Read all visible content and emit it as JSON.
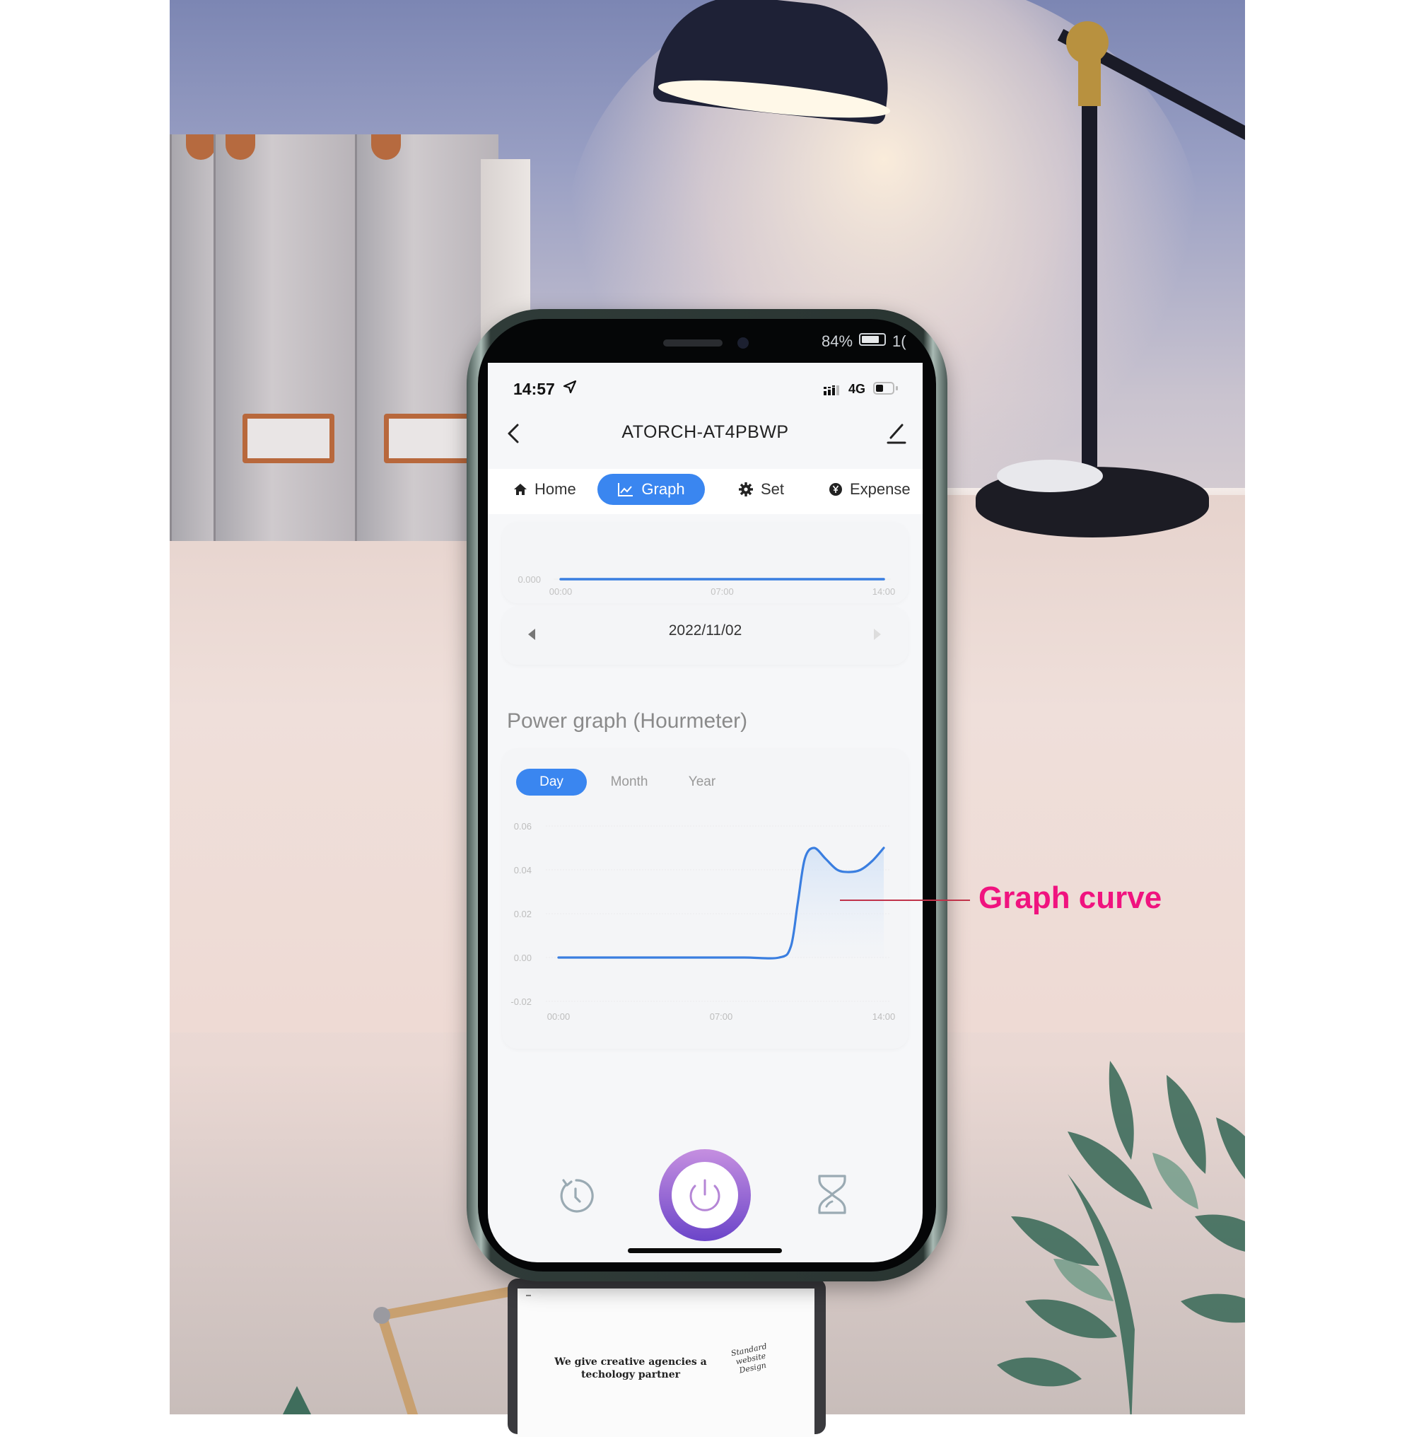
{
  "background_photo": {
    "tablet_headline": "We give creative agencies a techology partner",
    "tablet_script": "Standard website Design"
  },
  "phone_bezel": {
    "battery_percent": "84%",
    "battery_tail": "1("
  },
  "status_bar": {
    "time": "14:57",
    "location_icon": "location-arrow-icon",
    "network": "4G",
    "battery_level": 0.45
  },
  "header": {
    "title": "ATORCH-AT4PBWP",
    "back_icon": "chevron-left-icon",
    "edit_icon": "pencil-icon"
  },
  "tabs": [
    {
      "label": "Home",
      "icon": "home-icon",
      "active": false
    },
    {
      "label": "Graph",
      "icon": "line-chart-icon",
      "active": true
    },
    {
      "label": "Set",
      "icon": "gear-icon",
      "active": false
    },
    {
      "label": "Expense",
      "icon": "yen-coin-icon",
      "active": false
    }
  ],
  "date_nav": {
    "date": "2022/11/02",
    "prev_icon": "caret-left-icon",
    "next_icon": "caret-right-icon"
  },
  "power_graph": {
    "title": "Power graph (Hourmeter)",
    "periods": [
      {
        "label": "Day",
        "active": true
      },
      {
        "label": "Month",
        "active": false
      },
      {
        "label": "Year",
        "active": false
      }
    ]
  },
  "bottom_bar": {
    "left_icon": "timer-clock-icon",
    "center_icon": "power-icon",
    "right_icon": "hourglass-icon"
  },
  "annotation": {
    "text": "Graph curve",
    "color": "#f0137f"
  },
  "colors": {
    "accent": "#3a86f0",
    "power_gradient_top": "#c58fe0",
    "power_gradient_bottom": "#6b45c9"
  },
  "chart_data": [
    {
      "type": "line",
      "title": "",
      "xlabel": "",
      "ylabel": "",
      "x_ticks": [
        "00:00",
        "07:00",
        "14:00"
      ],
      "y_ticks": [
        "0.000"
      ],
      "x": [
        0,
        14
      ],
      "values": [
        0,
        0
      ],
      "xlim": [
        0,
        14
      ],
      "grid": true
    },
    {
      "type": "area",
      "title": "Power graph (Hourmeter)",
      "xlabel": "",
      "ylabel": "",
      "x_ticks": [
        "00:00",
        "07:00",
        "14:00"
      ],
      "y_ticks": [
        "0.06",
        "0.04",
        "0.02",
        "0.00",
        "-0.02"
      ],
      "ylim": [
        -0.02,
        0.06
      ],
      "xlim": [
        0,
        14
      ],
      "grid": true,
      "x": [
        0,
        2,
        4,
        6,
        8,
        9.5,
        10.0,
        10.3,
        10.6,
        11.0,
        11.5,
        12.0,
        12.5,
        13.0,
        13.5,
        14.0
      ],
      "values": [
        0,
        0,
        0,
        0,
        0,
        0,
        0.005,
        0.025,
        0.045,
        0.05,
        0.045,
        0.04,
        0.039,
        0.04,
        0.044,
        0.05
      ]
    }
  ]
}
